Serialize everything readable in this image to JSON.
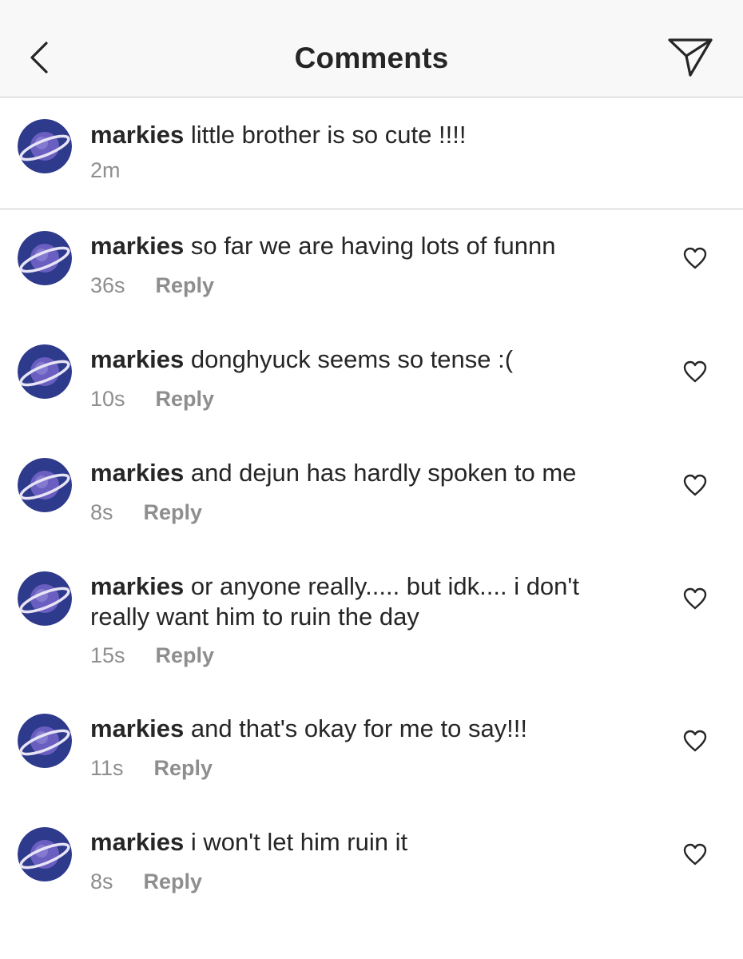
{
  "header": {
    "title": "Comments",
    "back_icon": "chevron-left-icon",
    "send_icon": "paper-plane-icon"
  },
  "caption": {
    "username": "markies",
    "text": "little brother is so cute !!!!",
    "time": "2m"
  },
  "comments": [
    {
      "username": "markies",
      "text": "so far we are having lots of funnn",
      "time": "36s",
      "reply_label": "Reply"
    },
    {
      "username": "markies",
      "text": "donghyuck seems so tense :(",
      "time": "10s",
      "reply_label": "Reply"
    },
    {
      "username": "markies",
      "text": "and dejun has hardly spoken to me",
      "time": "8s",
      "reply_label": "Reply"
    },
    {
      "username": "markies",
      "text": "or anyone really..... but idk.... i don't really want him to ruin the day",
      "time": "15s",
      "reply_label": "Reply"
    },
    {
      "username": "markies",
      "text": "and that's okay for me to say!!!",
      "time": "11s",
      "reply_label": "Reply"
    },
    {
      "username": "markies",
      "text": "i won't let him ruin it",
      "time": "8s",
      "reply_label": "Reply"
    }
  ],
  "colors": {
    "header_bg": "#f8f8f8",
    "text": "#262626",
    "secondary_text": "#8e8e8e",
    "avatar_bg": "#2e3a8c"
  }
}
